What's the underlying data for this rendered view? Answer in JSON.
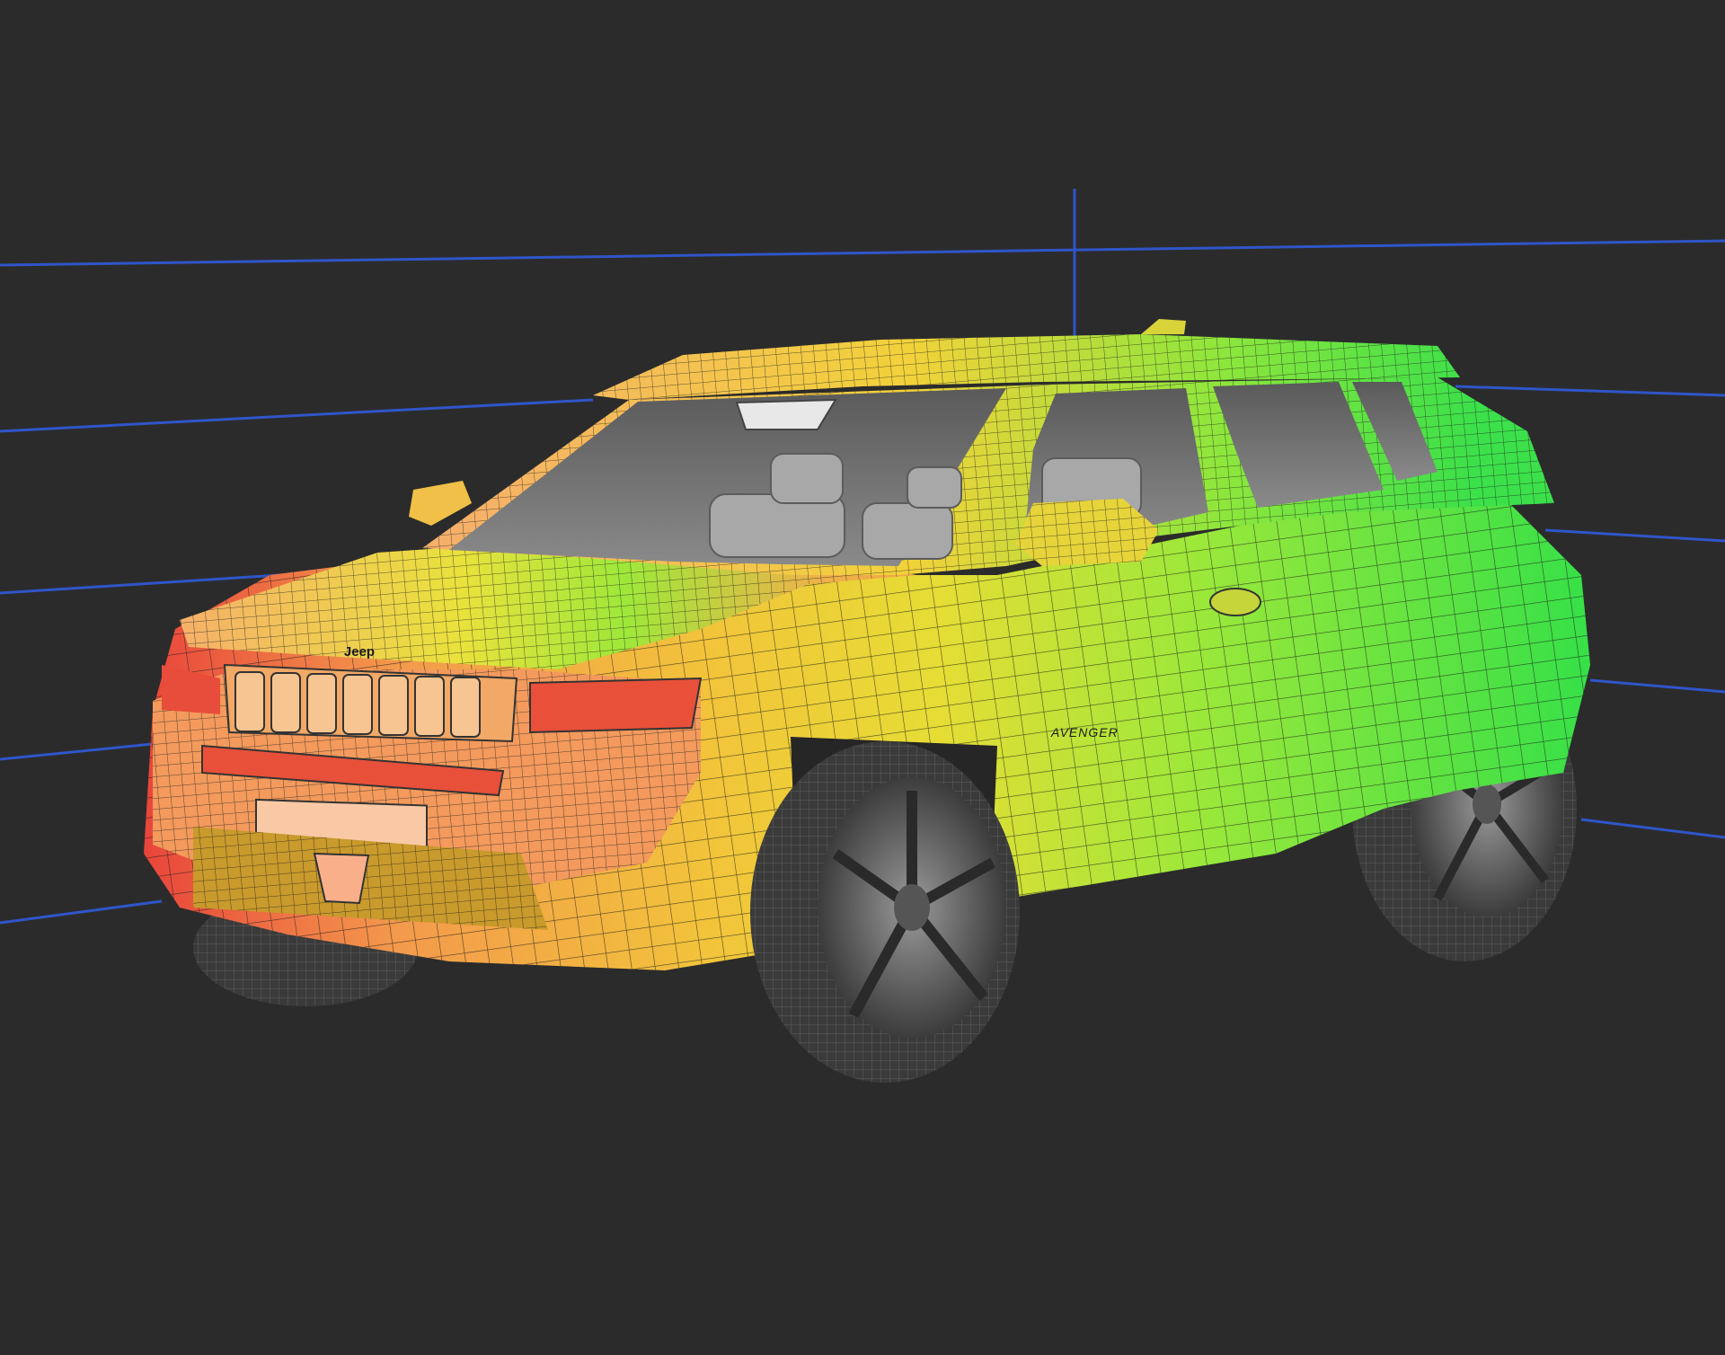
{
  "viewport": {
    "background_color": "#2b2b2b",
    "guide_line_color": "#2f55c8"
  },
  "model": {
    "brand_badge": "Jeep",
    "side_badge": "AVENGER",
    "heatmap_colors": [
      "#e8423a",
      "#f39a4c",
      "#f2d23a",
      "#c8e83a",
      "#34e048"
    ],
    "wireframe_color": "#1c1c1c",
    "tire_color": "#3a3a3a",
    "glass_color": "#6f6f6f"
  }
}
